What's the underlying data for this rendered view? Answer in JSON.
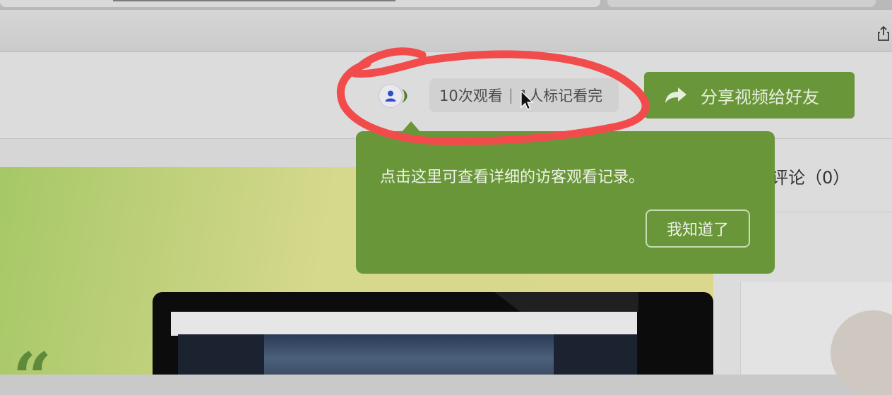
{
  "header": {
    "view_count": "10次观看",
    "separator": "|",
    "completed": "1人标记看完",
    "share_button_label": "分享视频给好友"
  },
  "tooltip": {
    "message": "点击这里可查看详细的访客观看记录。",
    "dismiss_label": "我知道了"
  },
  "sidebar": {
    "comments_tab": "评论（0）"
  },
  "banner": {
    "quote_mark": "“"
  },
  "icons": {
    "share": "share-arrow-icon",
    "avatar": "user-avatar-icon",
    "os_share": "share-upload-icon",
    "cursor": "mouse-pointer-icon"
  },
  "colors": {
    "accent_green": "#6a963a",
    "annotation_red": "#f24b4b"
  }
}
